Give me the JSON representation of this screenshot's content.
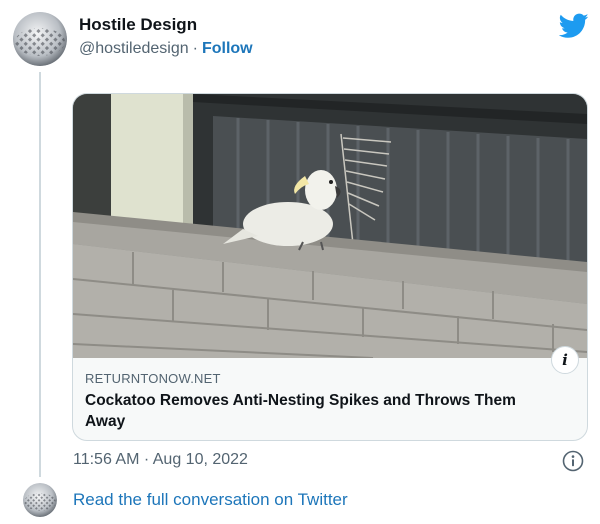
{
  "tweet": {
    "author_name": "Hostile Design",
    "author_handle": "@hostiledesign",
    "separator": "·",
    "follow_label": "Follow",
    "timestamp": "11:56 AM · Aug 10, 2022"
  },
  "card": {
    "domain": "RETURNTONOW.NET",
    "title": "Cockatoo Removes Anti-Nesting Spikes and Throws Them Away",
    "info_glyph": "i"
  },
  "footer": {
    "read_more_label": "Read the full conversation on Twitter"
  },
  "colors": {
    "twitter_blue": "#1d9bf0",
    "link_blue": "#1d76ba",
    "secondary_text": "#536471",
    "border": "#cfd9de"
  },
  "icons": {
    "brand": "twitter-bird-icon",
    "info": "info-circle-icon"
  }
}
